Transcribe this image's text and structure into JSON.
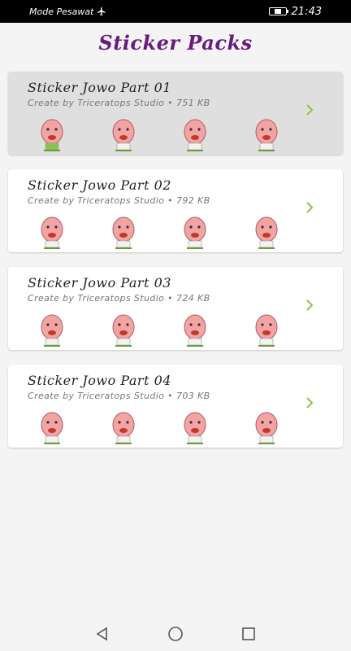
{
  "status_bar": {
    "carrier_mode": "Mode Pesawat",
    "airplane_icon": "airplane-icon",
    "time": "21:43"
  },
  "app": {
    "title": "Sticker Packs",
    "accent_color": "#6a1b7c",
    "chevron_color": "#8bc34a"
  },
  "packs": [
    {
      "name": "Sticker Jowo Part 01",
      "meta": "Create by Triceratops Studio • 751 KB",
      "selected": true
    },
    {
      "name": "Sticker Jowo Part 02",
      "meta": "Create by Triceratops Studio • 792 KB",
      "selected": false
    },
    {
      "name": "Sticker Jowo Part 03",
      "meta": "Create by Triceratops Studio • 724 KB",
      "selected": false
    },
    {
      "name": "Sticker Jowo Part 04",
      "meta": "Create by Triceratops Studio • 703 KB",
      "selected": false
    }
  ],
  "nav": {
    "back_icon": "back-triangle-icon",
    "home_icon": "home-circle-icon",
    "recents_icon": "recents-square-icon"
  }
}
